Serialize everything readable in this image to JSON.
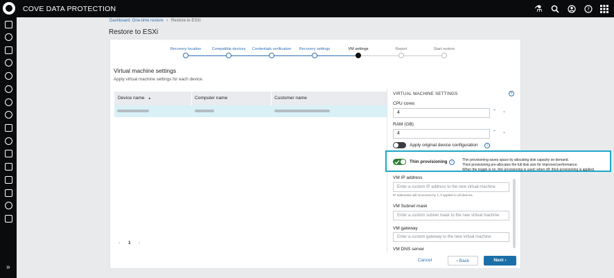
{
  "app": {
    "brand": "COVE DATA PROTECTION"
  },
  "breadcrumb": {
    "items": [
      "Dashboard: One-time restore",
      "Restore to ESXi"
    ],
    "separator": "›"
  },
  "page": {
    "title": "Restore to ESXi"
  },
  "stepper": {
    "steps": [
      {
        "label": "Recovery location",
        "state": "done"
      },
      {
        "label": "Compatible devices",
        "state": "done"
      },
      {
        "label": "Credentials verification",
        "state": "done"
      },
      {
        "label": "Recovery settings",
        "state": "done"
      },
      {
        "label": "VM settings",
        "state": "current"
      },
      {
        "label": "Report",
        "state": "pending"
      },
      {
        "label": "Start restore",
        "state": "pending"
      }
    ]
  },
  "section": {
    "title": "Virtual machine settings",
    "subtitle": "Apply virtual machine settings for each device."
  },
  "table": {
    "columns": [
      "Device name",
      "Computer name",
      "Customer name"
    ],
    "sort_indicator": "▲"
  },
  "pagination": {
    "prev": "‹",
    "current": "1",
    "next": "›"
  },
  "vm_panel": {
    "title": "VIRTUAL MACHINE SETTINGS",
    "close_glyph": "×",
    "cpu_label": "CPU cores",
    "cpu_value": "4",
    "ram_label": "RAM (GB)",
    "ram_value": "4",
    "apply_original_label": "Apply original device configuration",
    "apply_original_on": false,
    "thin_label": "Thin provisioning",
    "thin_on": true,
    "thin_tooltip": [
      "Thin provisioning saves space by allocating disk capacity on demand.",
      "Thick provisioning pre-allocates the full disk size for improved performance.",
      "When the toggle is on, thin provisioning is used; when off, thick provisioning is applied."
    ],
    "ip_label": "VM IP address",
    "ip_placeholder": "Enter a custom IP address to the new virtual machine",
    "ip_hint": "IP addresses will increment by 1, if applied to all devices.",
    "subnet_label": "VM Subnet mask",
    "subnet_placeholder": "Enter a custom subnet mask to the new virtual machine",
    "gateway_label": "VM gateway",
    "gateway_placeholder": "Enter a custom gateway to the new virtual machine",
    "dns_label": "VM DNS server"
  },
  "footer": {
    "cancel": "Cancel",
    "back": "‹ Back",
    "next": "Next ›"
  },
  "icons": {
    "up": "⌃",
    "down": "⌄",
    "info": "i"
  },
  "colors": {
    "accent": "#2d6fb3",
    "toggle_on": "#2e7d32",
    "highlight": "#1fa7c9",
    "primary": "#1b6fa8"
  }
}
